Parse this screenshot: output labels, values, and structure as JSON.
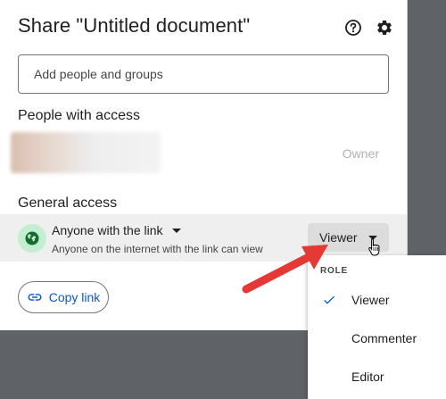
{
  "dialog": {
    "title": "Share \"Untitled document\"",
    "help_icon": "help-circle-icon",
    "settings_icon": "gear-icon"
  },
  "add_people": {
    "placeholder": "Add people and groups"
  },
  "people_with_access": {
    "label": "People with access",
    "owner_role": "Owner"
  },
  "general_access": {
    "label": "General access",
    "scope": "Anyone with the link",
    "description": "Anyone on the internet with the link can view",
    "role_button": "Viewer",
    "icon": "globe-icon"
  },
  "copy_link": {
    "label": "Copy link",
    "icon": "link-icon"
  },
  "role_menu": {
    "heading": "ROLE",
    "items": [
      {
        "label": "Viewer",
        "selected": true
      },
      {
        "label": "Commenter",
        "selected": false
      },
      {
        "label": "Editor",
        "selected": false
      }
    ]
  },
  "colors": {
    "accent": "#0b57d0",
    "annotation_arrow": "#e53935",
    "globe_bg": "#c4eed0",
    "globe": "#146c2e",
    "backdrop": "#5f6368"
  }
}
